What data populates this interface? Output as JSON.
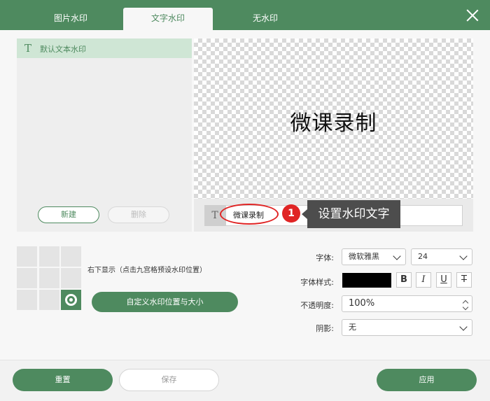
{
  "tabs": [
    {
      "label": "图片水印"
    },
    {
      "label": "文字水印"
    },
    {
      "label": "无水印"
    }
  ],
  "active_tab": "文字水印",
  "watermark_list": {
    "items": [
      {
        "icon": "T",
        "label": "默认文本水印"
      }
    ],
    "new_label": "新建",
    "delete_label": "删除"
  },
  "preview": {
    "text": "微课录制"
  },
  "text_input": {
    "icon": "T",
    "value": "微课录制"
  },
  "annotation": {
    "step": "1",
    "tooltip": "设置水印文字",
    "accent_color": "#e02424"
  },
  "position": {
    "label": "右下显示（点击九宫格预设水印位置）",
    "selected_cell": 8,
    "custom_button": "自定义水印位置与大小"
  },
  "font": {
    "label": "字体:",
    "family": "微软雅黑",
    "size": "24",
    "style_label": "字体样式:",
    "color": "#000000",
    "bold": "B",
    "italic": "I",
    "underline": "U",
    "strike": "T"
  },
  "opacity": {
    "label": "不透明度:",
    "value": "100%"
  },
  "shadow": {
    "label": "阴影:",
    "value": "无"
  },
  "footer": {
    "reset": "重置",
    "save": "保存",
    "apply": "应用"
  },
  "colors": {
    "brand": "#4e8a5f",
    "selected_row": "#cfe6d5"
  }
}
